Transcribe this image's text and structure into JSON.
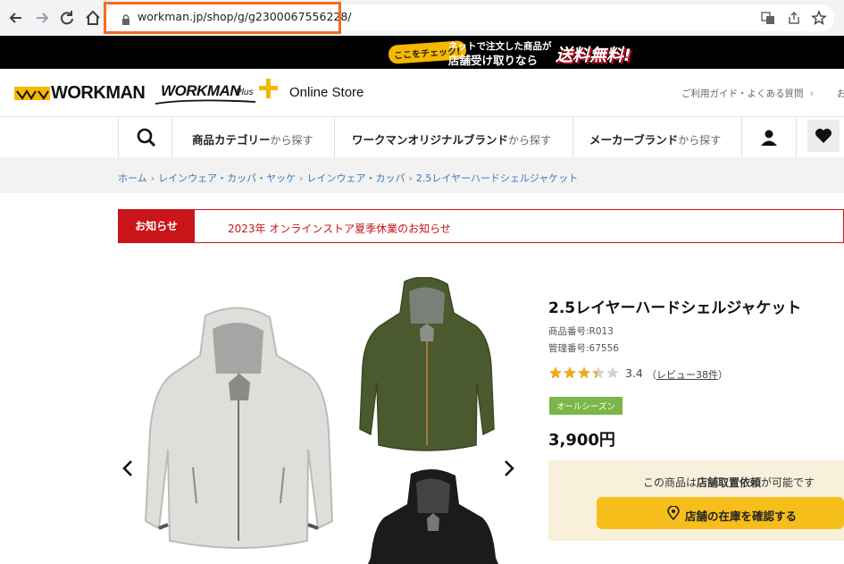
{
  "browser": {
    "url": "workman.jp/shop/g/g2300067556228/",
    "back_icon": "arrow-left-icon",
    "forward_icon": "arrow-right-icon",
    "reload_icon": "reload-icon",
    "home_icon": "home-icon"
  },
  "promo": {
    "check_label": "ここをチェック!",
    "line1": "ネットで注文した商品が",
    "line2": "店舗受け取りなら",
    "free_label": "送料無料!"
  },
  "header": {
    "logo_main": "WORKMAN",
    "logo_plus": "WORKMAN",
    "logo_plus_suffix": "Plus",
    "store_label": "Online Store",
    "guide_link": "ご利用ガイド・よくある質問",
    "guide_more": "お"
  },
  "catnav": {
    "category_bold": "商品カテゴリー",
    "category_suffix": "から探す",
    "brand_bold": "ワークマンオリジナルブランド",
    "brand_suffix": "から探す",
    "maker_bold": "メーカーブランド",
    "maker_suffix": "から探す"
  },
  "breadcrumb": [
    "ホーム",
    "レインウェア・カッパ・ヤッケ",
    "レインウェア・カッパ",
    "2.5レイヤーハードシェルジャケット"
  ],
  "notice": {
    "tag": "お知らせ",
    "text": "2023年 オンラインストア夏季休業のお知らせ"
  },
  "product": {
    "title": "2.5レイヤーハードシェルジャケット",
    "item_number": "商品番号:R013",
    "management_number": "管理番号:67556",
    "rating_value": 3.4,
    "rating_text": "3.4",
    "review_prefix": "（",
    "review_link": "レビュー38件",
    "review_suffix": "）",
    "season_tag": "オールシーズン",
    "price": "3,900円",
    "stock_msg_pre": "この商品は",
    "stock_msg_bold": "店舗取置依頼",
    "stock_msg_post": "が可能です",
    "stock_button": "店舗の在庫を確認する"
  },
  "colors": {
    "accent_red": "#c9141a",
    "accent_yellow": "#f6be1a",
    "link_blue": "#3a7abf",
    "season_green": "#7ab648",
    "url_highlight": "#f26c22"
  }
}
